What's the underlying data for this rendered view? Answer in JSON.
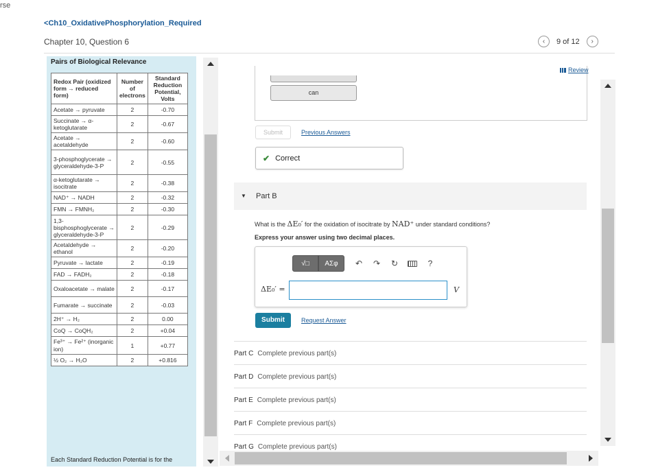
{
  "corner_text": "rse",
  "header": {
    "back_link": "Ch10_OxidativePhosphorylation_Required",
    "chapter_title": "Chapter 10, Question 6",
    "pager_text": "9 of 12"
  },
  "left_panel": {
    "title": "Pairs of Biological Relevance",
    "table_headers": [
      "Redox Pair (oxidized form → reduced form)",
      "Number of electrons",
      "Standard Reduction Potential, Volts"
    ],
    "rows": [
      [
        "Acetate → pyruvate",
        "2",
        "-0.70"
      ],
      [
        "Succinate → α-ketoglutarate",
        "2",
        "-0.67"
      ],
      [
        "Acetate → acetaldehyde",
        "2",
        "-0.60"
      ],
      [
        "3-phosphoglycerate → glyceraldehyde-3-P",
        "2",
        "-0.55"
      ],
      [
        "α-ketoglutarate → isocitrate",
        "2",
        "-0.38"
      ],
      [
        "NAD⁺ → NADH",
        "2",
        "-0.32"
      ],
      [
        "FMN → FMNH₂",
        "2",
        "-0.30"
      ],
      [
        "1,3-bisphosphoglycerate → glyceraldehyde-3-P",
        "2",
        "-0.29"
      ],
      [
        "Acetaldehyde → ethanol",
        "2",
        "-0.20"
      ],
      [
        "Pyruvate → lactate",
        "2",
        "-0.19"
      ],
      [
        "FAD → FADH₂",
        "2",
        "-0.18"
      ],
      [
        "Oxaloacetate → malate",
        "2",
        "-0.17"
      ],
      [
        "Fumarate → succinate",
        "2",
        "-0.03"
      ],
      [
        "2H⁺ → H₂",
        "2",
        "0.00"
      ],
      [
        "CoQ → CoQH₂",
        "2",
        "+0.04"
      ],
      [
        "Fe³⁺ → Fe²⁺ (inorganic ion)",
        "1",
        "+0.77"
      ],
      [
        "½ O₂ → H₂O",
        "2",
        "+0.816"
      ]
    ],
    "footnote": "Each Standard Reduction Potential is for the"
  },
  "part_a": {
    "can_label": "can",
    "submit_label": "Submit",
    "previous_answers": "Previous Answers",
    "correct_label": "Correct"
  },
  "part_b": {
    "label": "Part B",
    "question_pre": "What is the",
    "question_symbol": "ΔE₀′",
    "question_mid": "for the oxidation of isocitrate by",
    "question_nad": "NAD⁺",
    "question_post": "under standard conditions?",
    "instruction": "Express your answer using two decimal places.",
    "toolbar_templates": "√□",
    "toolbar_symbols": "ΑΣφ",
    "input_label": "ΔE₀′ =",
    "input_value": "",
    "unit": "V",
    "submit_label": "Submit",
    "request_answer": "Request Answer"
  },
  "parts": [
    {
      "label": "Part C",
      "status": "Complete previous part(s)"
    },
    {
      "label": "Part D",
      "status": "Complete previous part(s)"
    },
    {
      "label": "Part E",
      "status": "Complete previous part(s)"
    },
    {
      "label": "Part F",
      "status": "Complete previous part(s)"
    },
    {
      "label": "Part G",
      "status": "Complete previous part(s)"
    }
  ],
  "review_label": "Review"
}
